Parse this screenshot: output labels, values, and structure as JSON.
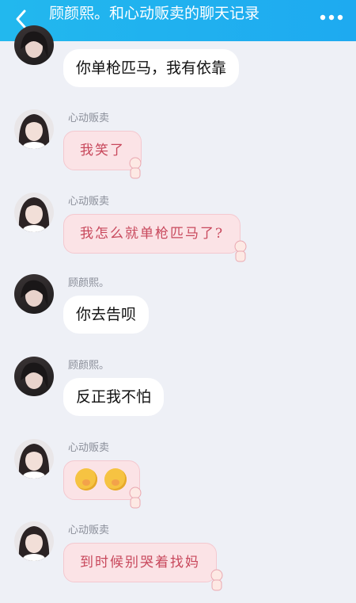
{
  "header": {
    "title": "顾颜熙。和心动贩卖的聊天记录",
    "back_icon": "chevron-left-icon",
    "more_icon": "more-dots-icon",
    "bg_color": "#22b8ee"
  },
  "messages": [
    {
      "sender": "",
      "text": "你单枪匹马，我有依靠",
      "style": "white"
    },
    {
      "sender": "心动贩卖",
      "text": "我笑了",
      "style": "pink"
    },
    {
      "sender": "心动贩卖",
      "text": "我怎么就单枪匹马了?",
      "style": "pink"
    },
    {
      "sender": "顾颜熙。",
      "text": "你去告呗",
      "style": "white"
    },
    {
      "sender": "顾颜熙。",
      "text": "反正我不怕",
      "style": "white"
    },
    {
      "sender": "心动贩卖",
      "text": "",
      "style": "pink",
      "emoji": [
        "giggle-emoji",
        "giggle-emoji"
      ]
    },
    {
      "sender": "心动贩卖",
      "text": "到时候别哭着找妈",
      "style": "pink"
    }
  ],
  "colors": {
    "pink_bubble": "#fbe3e6",
    "pink_text": "#c8485c",
    "bg": "#eef0f6"
  }
}
